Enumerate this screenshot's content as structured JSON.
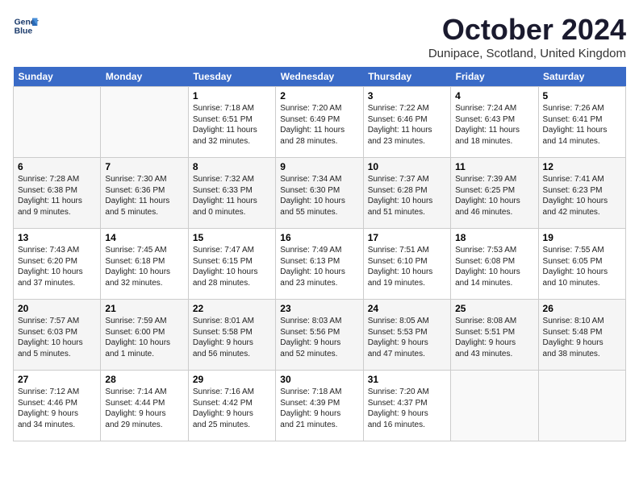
{
  "logo": {
    "line1": "General",
    "line2": "Blue"
  },
  "title": "October 2024",
  "location": "Dunipace, Scotland, United Kingdom",
  "weekdays": [
    "Sunday",
    "Monday",
    "Tuesday",
    "Wednesday",
    "Thursday",
    "Friday",
    "Saturday"
  ],
  "weeks": [
    [
      {
        "day": "",
        "info": ""
      },
      {
        "day": "",
        "info": ""
      },
      {
        "day": "1",
        "info": "Sunrise: 7:18 AM\nSunset: 6:51 PM\nDaylight: 11 hours\nand 32 minutes."
      },
      {
        "day": "2",
        "info": "Sunrise: 7:20 AM\nSunset: 6:49 PM\nDaylight: 11 hours\nand 28 minutes."
      },
      {
        "day": "3",
        "info": "Sunrise: 7:22 AM\nSunset: 6:46 PM\nDaylight: 11 hours\nand 23 minutes."
      },
      {
        "day": "4",
        "info": "Sunrise: 7:24 AM\nSunset: 6:43 PM\nDaylight: 11 hours\nand 18 minutes."
      },
      {
        "day": "5",
        "info": "Sunrise: 7:26 AM\nSunset: 6:41 PM\nDaylight: 11 hours\nand 14 minutes."
      }
    ],
    [
      {
        "day": "6",
        "info": "Sunrise: 7:28 AM\nSunset: 6:38 PM\nDaylight: 11 hours\nand 9 minutes."
      },
      {
        "day": "7",
        "info": "Sunrise: 7:30 AM\nSunset: 6:36 PM\nDaylight: 11 hours\nand 5 minutes."
      },
      {
        "day": "8",
        "info": "Sunrise: 7:32 AM\nSunset: 6:33 PM\nDaylight: 11 hours\nand 0 minutes."
      },
      {
        "day": "9",
        "info": "Sunrise: 7:34 AM\nSunset: 6:30 PM\nDaylight: 10 hours\nand 55 minutes."
      },
      {
        "day": "10",
        "info": "Sunrise: 7:37 AM\nSunset: 6:28 PM\nDaylight: 10 hours\nand 51 minutes."
      },
      {
        "day": "11",
        "info": "Sunrise: 7:39 AM\nSunset: 6:25 PM\nDaylight: 10 hours\nand 46 minutes."
      },
      {
        "day": "12",
        "info": "Sunrise: 7:41 AM\nSunset: 6:23 PM\nDaylight: 10 hours\nand 42 minutes."
      }
    ],
    [
      {
        "day": "13",
        "info": "Sunrise: 7:43 AM\nSunset: 6:20 PM\nDaylight: 10 hours\nand 37 minutes."
      },
      {
        "day": "14",
        "info": "Sunrise: 7:45 AM\nSunset: 6:18 PM\nDaylight: 10 hours\nand 32 minutes."
      },
      {
        "day": "15",
        "info": "Sunrise: 7:47 AM\nSunset: 6:15 PM\nDaylight: 10 hours\nand 28 minutes."
      },
      {
        "day": "16",
        "info": "Sunrise: 7:49 AM\nSunset: 6:13 PM\nDaylight: 10 hours\nand 23 minutes."
      },
      {
        "day": "17",
        "info": "Sunrise: 7:51 AM\nSunset: 6:10 PM\nDaylight: 10 hours\nand 19 minutes."
      },
      {
        "day": "18",
        "info": "Sunrise: 7:53 AM\nSunset: 6:08 PM\nDaylight: 10 hours\nand 14 minutes."
      },
      {
        "day": "19",
        "info": "Sunrise: 7:55 AM\nSunset: 6:05 PM\nDaylight: 10 hours\nand 10 minutes."
      }
    ],
    [
      {
        "day": "20",
        "info": "Sunrise: 7:57 AM\nSunset: 6:03 PM\nDaylight: 10 hours\nand 5 minutes."
      },
      {
        "day": "21",
        "info": "Sunrise: 7:59 AM\nSunset: 6:00 PM\nDaylight: 10 hours\nand 1 minute."
      },
      {
        "day": "22",
        "info": "Sunrise: 8:01 AM\nSunset: 5:58 PM\nDaylight: 9 hours\nand 56 minutes."
      },
      {
        "day": "23",
        "info": "Sunrise: 8:03 AM\nSunset: 5:56 PM\nDaylight: 9 hours\nand 52 minutes."
      },
      {
        "day": "24",
        "info": "Sunrise: 8:05 AM\nSunset: 5:53 PM\nDaylight: 9 hours\nand 47 minutes."
      },
      {
        "day": "25",
        "info": "Sunrise: 8:08 AM\nSunset: 5:51 PM\nDaylight: 9 hours\nand 43 minutes."
      },
      {
        "day": "26",
        "info": "Sunrise: 8:10 AM\nSunset: 5:48 PM\nDaylight: 9 hours\nand 38 minutes."
      }
    ],
    [
      {
        "day": "27",
        "info": "Sunrise: 7:12 AM\nSunset: 4:46 PM\nDaylight: 9 hours\nand 34 minutes."
      },
      {
        "day": "28",
        "info": "Sunrise: 7:14 AM\nSunset: 4:44 PM\nDaylight: 9 hours\nand 29 minutes."
      },
      {
        "day": "29",
        "info": "Sunrise: 7:16 AM\nSunset: 4:42 PM\nDaylight: 9 hours\nand 25 minutes."
      },
      {
        "day": "30",
        "info": "Sunrise: 7:18 AM\nSunset: 4:39 PM\nDaylight: 9 hours\nand 21 minutes."
      },
      {
        "day": "31",
        "info": "Sunrise: 7:20 AM\nSunset: 4:37 PM\nDaylight: 9 hours\nand 16 minutes."
      },
      {
        "day": "",
        "info": ""
      },
      {
        "day": "",
        "info": ""
      }
    ]
  ]
}
